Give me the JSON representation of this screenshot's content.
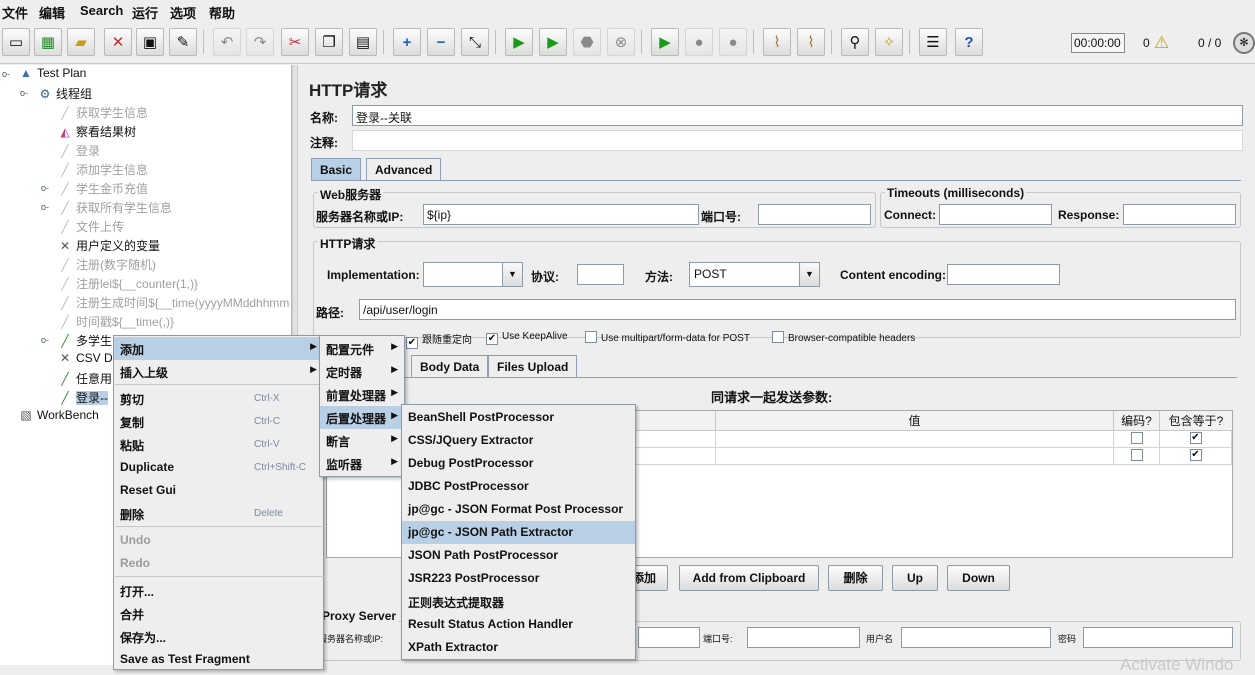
{
  "menubar": {
    "items": [
      "文件",
      "编辑",
      "Search",
      "运行",
      "选项",
      "帮助"
    ]
  },
  "toolbar": {
    "timer": "00:00:00",
    "warning_count": "0",
    "thread_count": "0 / 0"
  },
  "tree": {
    "nodes": [
      {
        "label": "Test Plan",
        "icon": "test-plan-icon"
      },
      {
        "label": "线程组",
        "icon": "gear-icon"
      },
      {
        "label": "获取学生信息",
        "icon": "sampler-icon"
      },
      {
        "label": "察看结果树",
        "icon": "chart-icon"
      },
      {
        "label": "登录",
        "icon": "sampler-icon"
      },
      {
        "label": "添加学生信息",
        "icon": "sampler-icon"
      },
      {
        "label": "学生金币充值",
        "icon": "sampler-icon"
      },
      {
        "label": "获取所有学生信息",
        "icon": "sampler-icon"
      },
      {
        "label": "文件上传",
        "icon": "sampler-icon"
      },
      {
        "label": "用户定义的变量",
        "icon": "wrench-icon"
      },
      {
        "label": "注册(数字随机)",
        "icon": "sampler-icon"
      },
      {
        "label": "注册lei${__counter(1,)}",
        "icon": "sampler-icon"
      },
      {
        "label": "注册生成时间${__time(yyyyMMddhhmm",
        "icon": "sampler-icon"
      },
      {
        "label": "时间戳${__time(,)}",
        "icon": "sampler-icon"
      },
      {
        "label": "多学生",
        "icon": "sampler-icon"
      },
      {
        "label": "CSV D",
        "icon": "wrench-icon"
      },
      {
        "label": "任意用",
        "icon": "sampler-icon"
      },
      {
        "label": "登录--",
        "icon": "sampler-icon"
      },
      {
        "label": "WorkBench",
        "icon": "workbench-icon"
      }
    ]
  },
  "http_request": {
    "title": "HTTP请求",
    "name_label": "名称:",
    "name_value": "登录--关联",
    "comment_label": "注释:",
    "comment_value": "",
    "tabs": [
      "Basic",
      "Advanced"
    ],
    "web_server": {
      "title": "Web服务器",
      "server_label": "服务器名称或IP:",
      "server_value": "${ip}",
      "port_label": "端口号:",
      "port_value": ""
    },
    "timeouts": {
      "title": "Timeouts (milliseconds)",
      "connect_label": "Connect:",
      "connect_value": "",
      "response_label": "Response:",
      "response_value": ""
    },
    "http_section": {
      "title": "HTTP请求",
      "implementation_label": "Implementation:",
      "implementation_value": "",
      "protocol_label": "协议:",
      "protocol_value": "",
      "method_label": "方法:",
      "method_value": "POST",
      "encoding_label": "Content encoding:",
      "encoding_value": "",
      "path_label": "路径:",
      "path_value": "/api/user/login"
    },
    "options": [
      {
        "label": "跟随重定向",
        "checked": true
      },
      {
        "label": "Use KeepAlive",
        "checked": true
      },
      {
        "label": "Use multipart/form-data for POST",
        "checked": false
      },
      {
        "label": "Browser-compatible headers",
        "checked": false
      }
    ],
    "sub_tabs": [
      "Body Data",
      "Files Upload"
    ],
    "params_caption": "同请求一起发送参数:",
    "params_columns": [
      "值",
      "编码?",
      "包含等于?"
    ],
    "params_rows": [
      {
        "encode": false,
        "include_equals": true
      },
      {
        "encode": false,
        "include_equals": true
      }
    ],
    "buttons": {
      "add": "添加",
      "add_clipboard": "Add from Clipboard",
      "delete": "删除",
      "up": "Up",
      "down": "Down"
    },
    "proxy": {
      "title": "Proxy Server",
      "server_label": "服务器名称或IP:",
      "port_label": "端口号:",
      "user_label": "用户名",
      "password_label": "密码"
    }
  },
  "context_menu": {
    "items": [
      {
        "label": "添加",
        "shortcut": "",
        "submenu": true,
        "highlighted": true,
        "disabled": false
      },
      {
        "label": "插入上级",
        "shortcut": "",
        "submenu": true,
        "highlighted": false,
        "disabled": false
      },
      {
        "label": "剪切",
        "shortcut": "Ctrl-X",
        "submenu": false,
        "highlighted": false,
        "disabled": false
      },
      {
        "label": "复制",
        "shortcut": "Ctrl-C",
        "submenu": false,
        "highlighted": false,
        "disabled": false
      },
      {
        "label": "粘贴",
        "shortcut": "Ctrl-V",
        "submenu": false,
        "highlighted": false,
        "disabled": false
      },
      {
        "label": "Duplicate",
        "shortcut": "Ctrl+Shift-C",
        "submenu": false,
        "highlighted": false,
        "disabled": false
      },
      {
        "label": "Reset Gui",
        "shortcut": "",
        "submenu": false,
        "highlighted": false,
        "disabled": false
      },
      {
        "label": "删除",
        "shortcut": "Delete",
        "submenu": false,
        "highlighted": false,
        "disabled": false
      },
      {
        "label": "Undo",
        "shortcut": "",
        "submenu": false,
        "highlighted": false,
        "disabled": true
      },
      {
        "label": "Redo",
        "shortcut": "",
        "submenu": false,
        "highlighted": false,
        "disabled": true
      },
      {
        "label": "打开...",
        "shortcut": "",
        "submenu": false,
        "highlighted": false,
        "disabled": false
      },
      {
        "label": "合并",
        "shortcut": "",
        "submenu": false,
        "highlighted": false,
        "disabled": false
      },
      {
        "label": "保存为...",
        "shortcut": "",
        "submenu": false,
        "highlighted": false,
        "disabled": false
      },
      {
        "label": "Save as Test Fragment",
        "shortcut": "",
        "submenu": false,
        "highlighted": false,
        "disabled": false
      }
    ]
  },
  "add_submenu": {
    "items": [
      {
        "label": "配置元件",
        "highlighted": false
      },
      {
        "label": "定时器",
        "highlighted": false
      },
      {
        "label": "前置处理器",
        "highlighted": false
      },
      {
        "label": "后置处理器",
        "highlighted": true
      },
      {
        "label": "断言",
        "highlighted": false
      },
      {
        "label": "监听器",
        "highlighted": false
      }
    ]
  },
  "postprocessor_submenu": {
    "items": [
      {
        "label": "BeanShell PostProcessor",
        "highlighted": false
      },
      {
        "label": "CSS/JQuery Extractor",
        "highlighted": false
      },
      {
        "label": "Debug PostProcessor",
        "highlighted": false
      },
      {
        "label": "JDBC PostProcessor",
        "highlighted": false
      },
      {
        "label": "jp@gc - JSON Format Post Processor",
        "highlighted": false
      },
      {
        "label": "jp@gc - JSON Path Extractor",
        "highlighted": true
      },
      {
        "label": "JSON Path PostProcessor",
        "highlighted": false
      },
      {
        "label": "JSR223 PostProcessor",
        "highlighted": false
      },
      {
        "label": "正则表达式提取器",
        "highlighted": false
      },
      {
        "label": "Result Status Action Handler",
        "highlighted": false
      },
      {
        "label": "XPath Extractor",
        "highlighted": false
      }
    ]
  },
  "colors": {
    "selection": "#b8cfe5",
    "background": "#eeeeee",
    "disabled_text": "#a0a0a0"
  },
  "watermark": "Activate Windo"
}
